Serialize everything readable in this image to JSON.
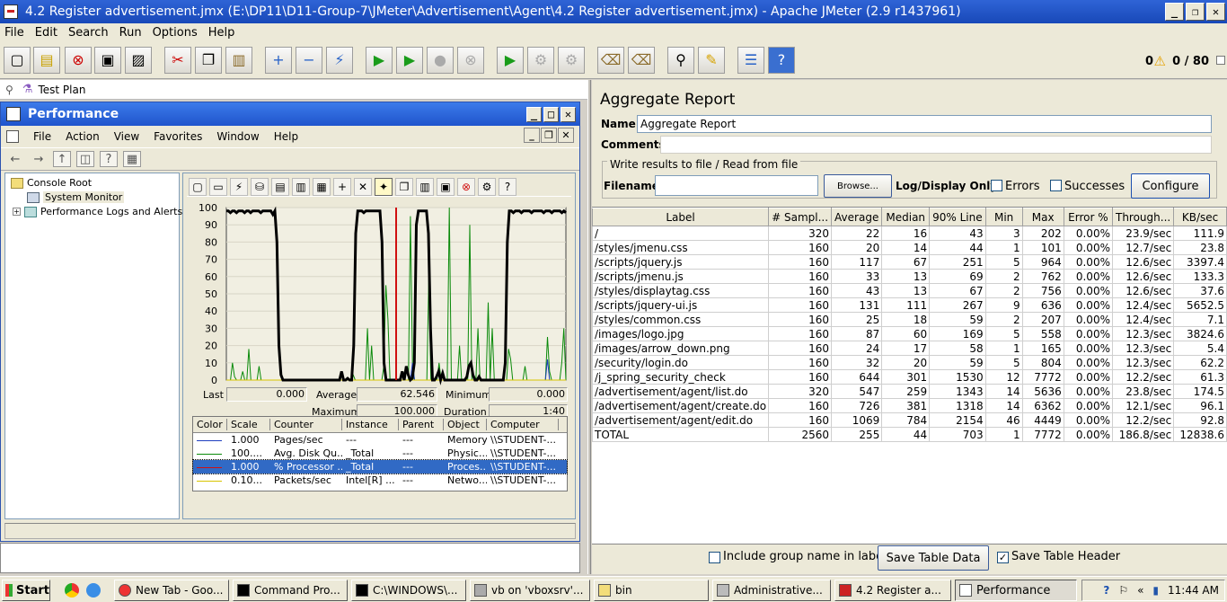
{
  "window": {
    "title": "4.2 Register advertisement.jmx (E:\\DP11\\D11-Group-7\\JMeter\\Advertisement\\Agent\\4.2 Register advertisement.jmx) - Apache JMeter (2.9 r1437961)"
  },
  "menu": [
    "File",
    "Edit",
    "Search",
    "Run",
    "Options",
    "Help"
  ],
  "status": {
    "errors": "0",
    "threads": "0 / 80"
  },
  "tree": {
    "test_plan": "Test Plan"
  },
  "perf_window": {
    "title": "Performance",
    "menu": [
      "File",
      "Action",
      "View",
      "Favorites",
      "Window",
      "Help"
    ],
    "tree": {
      "root": "Console Root",
      "system_monitor": "System Monitor",
      "logs": "Performance Logs and Alerts"
    }
  },
  "chart_data": {
    "type": "line",
    "title": "",
    "y_ticks": [
      "100",
      "90",
      "80",
      "70",
      "60",
      "50",
      "40",
      "30",
      "20",
      "10",
      "0"
    ],
    "ylim": [
      0,
      100
    ],
    "stats": {
      "last_label": "Last",
      "last": "0.000",
      "average_label": "Average",
      "average": "62.546",
      "minimum_label": "Minimum",
      "minimum": "0.000",
      "maximum_label": "Maximum",
      "maximum": "100.000",
      "duration_label": "Duration",
      "duration": "1:40"
    },
    "series": [
      {
        "name": "% Processor Time",
        "color": "#000000",
        "values": [
          98,
          98,
          97,
          98,
          98,
          97,
          98,
          98,
          98,
          97,
          98,
          98,
          97,
          98,
          98,
          98,
          98,
          97,
          98,
          98,
          98,
          98,
          98,
          96,
          98,
          80,
          20,
          3,
          0,
          0,
          0,
          0,
          0,
          0,
          0,
          0,
          0,
          0,
          0,
          0,
          0,
          0,
          0,
          0,
          0,
          0,
          0,
          0,
          0,
          0,
          0,
          0,
          0,
          0,
          0,
          0,
          0,
          5,
          0,
          0,
          1,
          0,
          0,
          20,
          85,
          98,
          98,
          98,
          97,
          98,
          98,
          98,
          98,
          98,
          98,
          98,
          98,
          80,
          10,
          0,
          0,
          0,
          0,
          0,
          0,
          0,
          0,
          5,
          0,
          8,
          3,
          0,
          1,
          10,
          90,
          98,
          98,
          98,
          98,
          98,
          85,
          30,
          0,
          0,
          2,
          5,
          0,
          4,
          0,
          0,
          0,
          0,
          0,
          0,
          0,
          0,
          0,
          0,
          0,
          2,
          8,
          10,
          3,
          0,
          0,
          2,
          0,
          0,
          0,
          0,
          0,
          0,
          0,
          0,
          0,
          0,
          0,
          0,
          10,
          80,
          98,
          98,
          97,
          98,
          98,
          98,
          97,
          98,
          98,
          98,
          98,
          97,
          98,
          98,
          98,
          98,
          98,
          97,
          98,
          98,
          98,
          97,
          98,
          98,
          98,
          98,
          97,
          98,
          97
        ]
      },
      {
        "name": "Avg. Disk Queue Length",
        "color": "#0a8a0a",
        "values": [
          0,
          0,
          0,
          10,
          2,
          0,
          0,
          0,
          5,
          0,
          0,
          18,
          0,
          0,
          0,
          0,
          8,
          0,
          0,
          0,
          0,
          0,
          0,
          0,
          0,
          0,
          0,
          0,
          0,
          0,
          0,
          0,
          0,
          0,
          0,
          0,
          0,
          0,
          0,
          0,
          0,
          0,
          0,
          0,
          0,
          0,
          0,
          0,
          0,
          0,
          0,
          0,
          0,
          0,
          0,
          0,
          0,
          0,
          0,
          0,
          0,
          0,
          3,
          0,
          0,
          0,
          0,
          0,
          0,
          30,
          0,
          20,
          0,
          0,
          0,
          0,
          0,
          8,
          55,
          35,
          0,
          0,
          0,
          0,
          0,
          0,
          0,
          0,
          0,
          0,
          95,
          10,
          0,
          0,
          0,
          0,
          0,
          0,
          0,
          60,
          0,
          0,
          0,
          0,
          10,
          0,
          0,
          0,
          0,
          100,
          0,
          0,
          0,
          0,
          20,
          0,
          0,
          0,
          0,
          90,
          0,
          0,
          0,
          30,
          0,
          0,
          0,
          0,
          45,
          0,
          30,
          0,
          0,
          0,
          0,
          0,
          0,
          0,
          18,
          12,
          0,
          0,
          0,
          0,
          0,
          0,
          8,
          0,
          0,
          0,
          0,
          0,
          0,
          0,
          0,
          0,
          0,
          25,
          5,
          0,
          0,
          0,
          0,
          0,
          10,
          30,
          0
        ]
      },
      {
        "name": "Pages/sec",
        "color": "#1f3fbf",
        "values": [
          0,
          0,
          0,
          0,
          0,
          0,
          0,
          0,
          0,
          0,
          0,
          0,
          0,
          0,
          0,
          0,
          0,
          0,
          0,
          0,
          0,
          0,
          0,
          0,
          0,
          0,
          0,
          0,
          0,
          0,
          0,
          0,
          0,
          0,
          0,
          0,
          0,
          0,
          0,
          0,
          0,
          0,
          0,
          0,
          0,
          0,
          0,
          0,
          0,
          0,
          0,
          0,
          0,
          0,
          0,
          0,
          0,
          0,
          0,
          0,
          0,
          0,
          0,
          0,
          0,
          0,
          0,
          0,
          0,
          0,
          0,
          0,
          0,
          0,
          0,
          0,
          0,
          0,
          0,
          0,
          0,
          0,
          0,
          0,
          0,
          0,
          0,
          0,
          0,
          0,
          0,
          10,
          0,
          0,
          0,
          0,
          0,
          0,
          0,
          0,
          0,
          0,
          0,
          0,
          0,
          0,
          0,
          0,
          0,
          0,
          0,
          0,
          0,
          0,
          0,
          0,
          0,
          0,
          0,
          0,
          0,
          0,
          0,
          0,
          0,
          0,
          0,
          0,
          0,
          0,
          0,
          0,
          0,
          0,
          0,
          0,
          0,
          0,
          0,
          0,
          0,
          0,
          0,
          0,
          0,
          0,
          0,
          0,
          0,
          0,
          0,
          0,
          0,
          0,
          0,
          0,
          0,
          12,
          0,
          0,
          0,
          0,
          0,
          0,
          0,
          0,
          0
        ]
      },
      {
        "name": "Packets/sec",
        "color": "#d8c400",
        "values": [
          0,
          0,
          0,
          0,
          0,
          0,
          0,
          0,
          0,
          0,
          0,
          0,
          0,
          0,
          0,
          0,
          0,
          0,
          0,
          0,
          0,
          0,
          0,
          0,
          0,
          0,
          0,
          0,
          0,
          0,
          0,
          0,
          0,
          0,
          0,
          0,
          0,
          0,
          0,
          0,
          0,
          0,
          0,
          0,
          0,
          0,
          0,
          0,
          0,
          0,
          0,
          0,
          0,
          0,
          0,
          0,
          0,
          0,
          0,
          0,
          0,
          0,
          0,
          0,
          0,
          0,
          0,
          0,
          0,
          0,
          0,
          0,
          0,
          0,
          0,
          0,
          0,
          0,
          0,
          0,
          0,
          0,
          0,
          0,
          0,
          0,
          0,
          0,
          0,
          0,
          0,
          0,
          0,
          0,
          0,
          0,
          0,
          0,
          0,
          0,
          0,
          0,
          0,
          0,
          0,
          0,
          0,
          0,
          0,
          0,
          0,
          0,
          0,
          0,
          0,
          0,
          0,
          0,
          0,
          0,
          0,
          0,
          0,
          0,
          0,
          0,
          0,
          0,
          0,
          0,
          0,
          0,
          0,
          0,
          0,
          0,
          0,
          0,
          0,
          0,
          0,
          0,
          0,
          0,
          0,
          0,
          0,
          0,
          0,
          0,
          0,
          0,
          0,
          0,
          0,
          0,
          0,
          0,
          0,
          0,
          0,
          0,
          0,
          0,
          0,
          0,
          0
        ]
      }
    ],
    "current_marker": 0.5,
    "marker_color": "#d01010"
  },
  "counters": {
    "headers": [
      "Color",
      "Scale",
      "Counter",
      "Instance",
      "Parent",
      "Object",
      "Computer"
    ],
    "rows": [
      {
        "color": "#1f3fbf",
        "scale": "1.000",
        "counter": "Pages/sec",
        "instance": "---",
        "parent": "---",
        "object": "Memory",
        "computer": "\\\\STUDENT-..."
      },
      {
        "color": "#0a8a0a",
        "scale": "100....",
        "counter": "Avg. Disk Qu...",
        "instance": "_Total",
        "parent": "---",
        "object": "Physic...",
        "computer": "\\\\STUDENT-..."
      },
      {
        "color": "#d01010",
        "scale": "1.000",
        "counter": "% Processor ...",
        "instance": "_Total",
        "parent": "---",
        "object": "Proces...",
        "computer": "\\\\STUDENT-..."
      },
      {
        "color": "#d8c400",
        "scale": "0.10...",
        "counter": "Packets/sec",
        "instance": "Intel[R] ...",
        "parent": "---",
        "object": "Netwo...",
        "computer": "\\\\STUDENT-..."
      }
    ]
  },
  "aggregate": {
    "title": "Aggregate Report",
    "name_label": "Name:",
    "name_value": "Aggregate Report",
    "comments_label": "Comments:",
    "file_legend": "Write results to file / Read from file",
    "filename_label": "Filename",
    "browse": "Browse...",
    "log_only": "Log/Display Only:",
    "errors": "Errors",
    "successes": "Successes",
    "configure": "Configure",
    "headers": [
      "Label",
      "# Sampl...",
      "Average",
      "Median",
      "90% Line",
      "Min",
      "Max",
      "Error %",
      "Through...",
      "KB/sec"
    ],
    "rows": [
      [
        "/",
        "320",
        "22",
        "16",
        "43",
        "3",
        "202",
        "0.00%",
        "23.9/sec",
        "111.9"
      ],
      [
        "/styles/jmenu.css",
        "160",
        "20",
        "14",
        "44",
        "1",
        "101",
        "0.00%",
        "12.7/sec",
        "23.8"
      ],
      [
        "/scripts/jquery.js",
        "160",
        "117",
        "67",
        "251",
        "5",
        "964",
        "0.00%",
        "12.6/sec",
        "3397.4"
      ],
      [
        "/scripts/jmenu.js",
        "160",
        "33",
        "13",
        "69",
        "2",
        "762",
        "0.00%",
        "12.6/sec",
        "133.3"
      ],
      [
        "/styles/displaytag.css",
        "160",
        "43",
        "13",
        "67",
        "2",
        "756",
        "0.00%",
        "12.6/sec",
        "37.6"
      ],
      [
        "/scripts/jquery-ui.js",
        "160",
        "131",
        "111",
        "267",
        "9",
        "636",
        "0.00%",
        "12.4/sec",
        "5652.5"
      ],
      [
        "/styles/common.css",
        "160",
        "25",
        "18",
        "59",
        "2",
        "207",
        "0.00%",
        "12.4/sec",
        "7.1"
      ],
      [
        "/images/logo.jpg",
        "160",
        "87",
        "60",
        "169",
        "5",
        "558",
        "0.00%",
        "12.3/sec",
        "3824.6"
      ],
      [
        "/images/arrow_down.png",
        "160",
        "24",
        "17",
        "58",
        "1",
        "165",
        "0.00%",
        "12.3/sec",
        "5.4"
      ],
      [
        "/security/login.do",
        "160",
        "32",
        "20",
        "59",
        "5",
        "804",
        "0.00%",
        "12.3/sec",
        "62.2"
      ],
      [
        "/j_spring_security_check",
        "160",
        "644",
        "301",
        "1530",
        "12",
        "7772",
        "0.00%",
        "12.2/sec",
        "61.3"
      ],
      [
        "/advertisement/agent/list.do",
        "320",
        "547",
        "259",
        "1343",
        "14",
        "5636",
        "0.00%",
        "23.8/sec",
        "174.5"
      ],
      [
        "/advertisement/agent/create.do",
        "160",
        "726",
        "381",
        "1318",
        "14",
        "6362",
        "0.00%",
        "12.1/sec",
        "96.1"
      ],
      [
        "/advertisement/agent/edit.do",
        "160",
        "1069",
        "784",
        "2154",
        "46",
        "4449",
        "0.00%",
        "12.2/sec",
        "92.8"
      ],
      [
        "TOTAL",
        "2560",
        "255",
        "44",
        "703",
        "1",
        "7772",
        "0.00%",
        "186.8/sec",
        "12838.6"
      ]
    ],
    "include_group": "Include group name in label?",
    "save_table": "Save Table Data",
    "save_header": "Save Table Header"
  },
  "taskbar": {
    "start": "Start",
    "tasks": [
      "New Tab - Goo...",
      "Command Pro...",
      "C:\\WINDOWS\\...",
      "vb on 'vboxsrv'...",
      "bin",
      "Administrative...",
      "4.2 Register a...",
      "Performance"
    ],
    "clock": "11:44 AM"
  }
}
